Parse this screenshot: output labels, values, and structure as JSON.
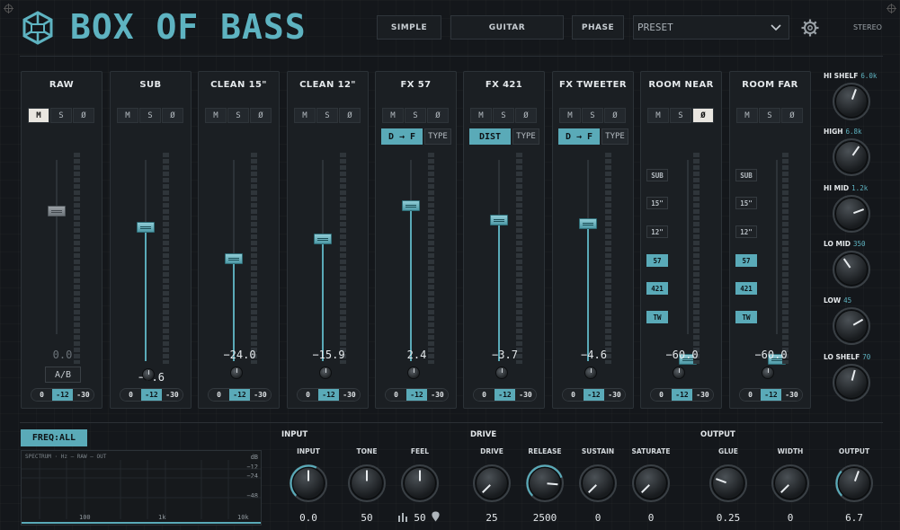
{
  "header": {
    "brand": "BOX OF BASS",
    "buttons": [
      "SIMPLE",
      "GUITAR",
      "PHASE"
    ],
    "preset": "PRESET",
    "stereo": "STEREO"
  },
  "channels": [
    {
      "name": "RAW",
      "mute": "M",
      "solo": "S",
      "phase": "Ø",
      "active": "M",
      "value": "0.0",
      "ab": "A/B",
      "fader_level": 0.87,
      "pad": [
        "0",
        "-12",
        "-30"
      ]
    },
    {
      "name": "SUB",
      "mute": "M",
      "solo": "S",
      "phase": "Ø",
      "value": "−8.6",
      "fader_level": 0.78,
      "pad": [
        "0",
        "-12",
        "-30"
      ]
    },
    {
      "name": "CLEAN 15\"",
      "mute": "M",
      "solo": "S",
      "phase": "Ø",
      "value": "−24.0",
      "fader_level": 0.6,
      "pad": [
        "0",
        "-12",
        "-30"
      ]
    },
    {
      "name": "CLEAN 12\"",
      "mute": "M",
      "solo": "S",
      "phase": "Ø",
      "value": "−15.9",
      "fader_level": 0.71,
      "pad": [
        "0",
        "-12",
        "-30"
      ]
    },
    {
      "name": "FX 57",
      "mute": "M",
      "solo": "S",
      "phase": "Ø",
      "fx": "D → F",
      "type": "TYPE",
      "value": "2.4",
      "fader_level": 0.9,
      "pad": [
        "0",
        "-12",
        "-30"
      ]
    },
    {
      "name": "FX 421",
      "mute": "M",
      "solo": "S",
      "phase": "Ø",
      "fx": "DIST",
      "type": "TYPE",
      "value": "−3.7",
      "fader_level": 0.82,
      "pad": [
        "0",
        "-12",
        "-30"
      ]
    },
    {
      "name": "FX TWEETER",
      "mute": "M",
      "solo": "S",
      "phase": "Ø",
      "fx": "D → F",
      "type": "TYPE",
      "value": "−4.6",
      "fader_level": 0.8,
      "pad": [
        "0",
        "-12",
        "-30"
      ]
    },
    {
      "name": "ROOM NEAR",
      "mute": "M",
      "solo": "S",
      "phase": "Ø",
      "active": "Ø",
      "value": "−60.0",
      "fader_level": 0.02,
      "sends": [
        "SUB",
        "15\"",
        "12\"",
        "57",
        "421",
        "TW"
      ],
      "pad": [
        "0",
        "-12",
        "-30"
      ]
    },
    {
      "name": "ROOM FAR",
      "mute": "M",
      "solo": "S",
      "phase": "Ø",
      "value": "−60.0",
      "fader_level": 0.02,
      "sends": [
        "SUB",
        "15\"",
        "12\"",
        "57",
        "421",
        "TW"
      ],
      "pad": [
        "0",
        "-12",
        "-30"
      ]
    }
  ],
  "eq": [
    {
      "label": "HI SHELF",
      "value": "6.0k"
    },
    {
      "label": "HIGH",
      "value": "6.8k"
    },
    {
      "label": "HI MID",
      "value": "1.2k"
    },
    {
      "label": "LO MID",
      "value": "350"
    },
    {
      "label": "LOW",
      "value": "45"
    },
    {
      "label": "LO SHELF",
      "value": "70"
    }
  ],
  "spectrum": {
    "button": "FREQ:ALL",
    "legend": "SPECTRUM  ·  Hz        — RAW    — OUT",
    "db_label": "dB",
    "db_ticks": [
      "−12",
      "−24",
      "−48"
    ],
    "x_ticks": [
      "100",
      "1k",
      "10k"
    ]
  },
  "sections": {
    "input": "INPUT",
    "drive": "DRIVE",
    "output": "OUTPUT"
  },
  "bottom_knobs": [
    {
      "label": "INPUT",
      "value": "0.0"
    },
    {
      "label": "TONE",
      "value": "50"
    },
    {
      "label": "FEEL",
      "value": "50"
    },
    {
      "label": "DRIVE",
      "value": "25"
    },
    {
      "label": "RELEASE",
      "value": "2500"
    },
    {
      "label": "SUSTAIN",
      "value": "0"
    },
    {
      "label": "SATURATE",
      "value": "0"
    },
    {
      "label": "GLUE",
      "value": "0.25"
    },
    {
      "label": "WIDTH",
      "value": "0"
    },
    {
      "label": "OUTPUT",
      "value": "6.7"
    }
  ],
  "colors": {
    "accent": "#5eb3c1",
    "panel": "#1b1f23",
    "bg": "#14171b"
  }
}
